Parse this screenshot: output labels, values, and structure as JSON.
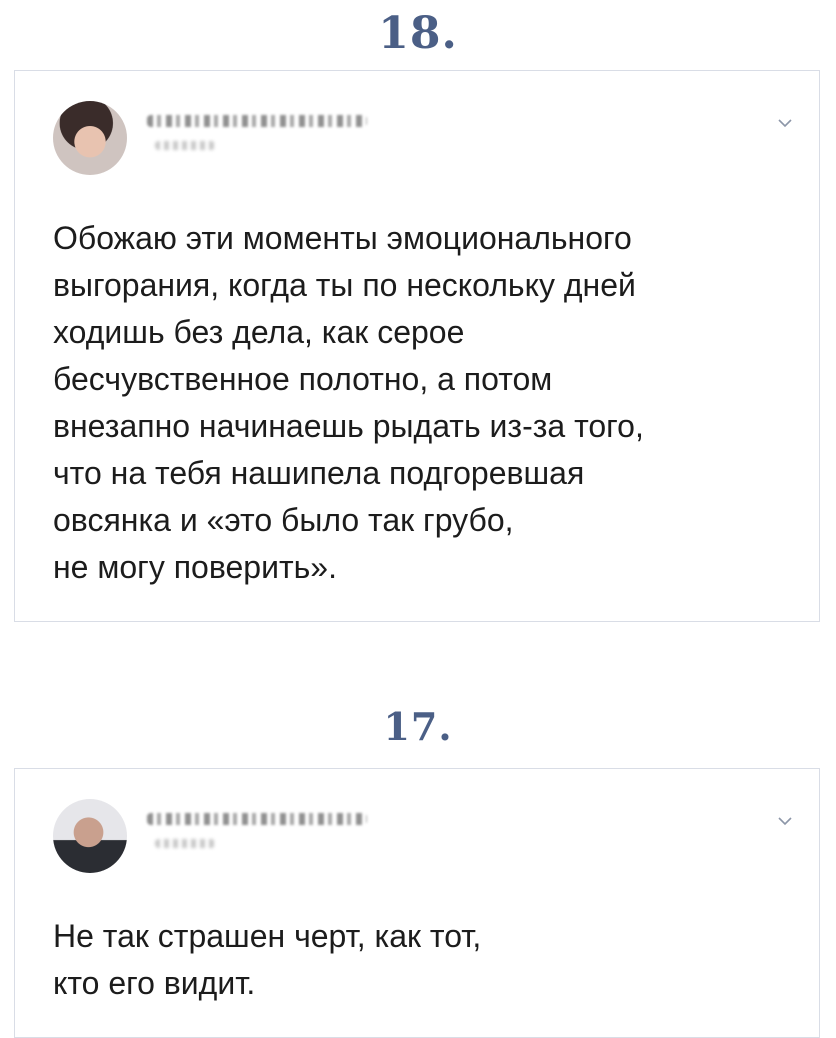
{
  "posts": [
    {
      "number": "18.",
      "text_lines": [
        "Обожаю эти моменты эмоционального",
        "выгорания, когда ты по нескольку дней",
        "ходишь без дела, как серое",
        "бесчувственное полотно, а потом",
        "внезапно начинаешь рыдать из-за того,",
        "что на тебя нашипела подгоревшая",
        "овсянка и «это было так грубо,",
        "не могу поверить»."
      ],
      "icons": {
        "avatar": "user-avatar",
        "menu": "chevron-down-icon"
      }
    },
    {
      "number": "17.",
      "text_lines": [
        "Не так страшен черт, как тот,",
        "кто его видит."
      ],
      "icons": {
        "avatar": "user-avatar",
        "menu": "chevron-down-icon"
      }
    }
  ],
  "colors": {
    "number": "#4b5f86",
    "text": "#1c1c1c",
    "card_border": "#d9dde6",
    "chevron": "#8c96a8"
  }
}
